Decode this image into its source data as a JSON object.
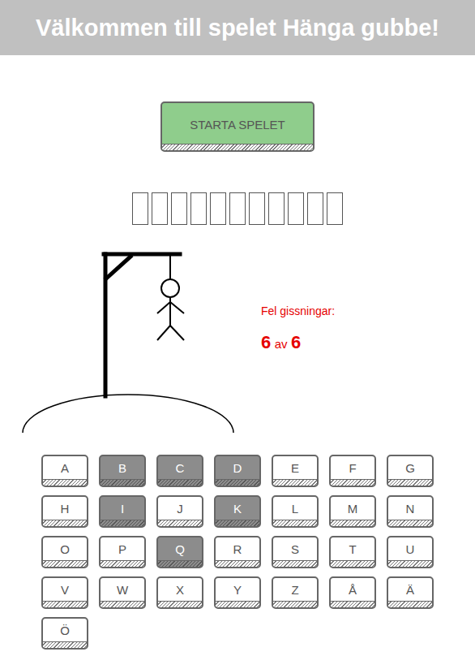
{
  "title": "Välkommen till spelet Hänga gubbe!",
  "start_button": {
    "label": "STARTA SPELET"
  },
  "word_slots": [
    {
      "revealed": false
    },
    {
      "revealed": false
    },
    {
      "revealed": false
    },
    {
      "revealed": false
    },
    {
      "revealed": false
    },
    {
      "revealed": false
    },
    {
      "revealed": false
    },
    {
      "revealed": false
    },
    {
      "revealed": false
    },
    {
      "revealed": false
    },
    {
      "revealed": false
    }
  ],
  "wrong_guesses": {
    "label": "Fel gissningar:",
    "count": "6",
    "separator": "av",
    "max": "6"
  },
  "keys": [
    {
      "letter": "A",
      "disabled": false
    },
    {
      "letter": "B",
      "disabled": true
    },
    {
      "letter": "C",
      "disabled": true
    },
    {
      "letter": "D",
      "disabled": true
    },
    {
      "letter": "E",
      "disabled": false
    },
    {
      "letter": "F",
      "disabled": false
    },
    {
      "letter": "G",
      "disabled": false
    },
    {
      "letter": "H",
      "disabled": false
    },
    {
      "letter": "I",
      "disabled": true
    },
    {
      "letter": "J",
      "disabled": false
    },
    {
      "letter": "K",
      "disabled": true
    },
    {
      "letter": "L",
      "disabled": false
    },
    {
      "letter": "M",
      "disabled": false
    },
    {
      "letter": "N",
      "disabled": false
    },
    {
      "letter": "O",
      "disabled": false
    },
    {
      "letter": "P",
      "disabled": false
    },
    {
      "letter": "Q",
      "disabled": true
    },
    {
      "letter": "R",
      "disabled": false
    },
    {
      "letter": "S",
      "disabled": false
    },
    {
      "letter": "T",
      "disabled": false
    },
    {
      "letter": "U",
      "disabled": false
    },
    {
      "letter": "V",
      "disabled": false
    },
    {
      "letter": "W",
      "disabled": false
    },
    {
      "letter": "X",
      "disabled": false
    },
    {
      "letter": "Y",
      "disabled": false
    },
    {
      "letter": "Z",
      "disabled": false
    },
    {
      "letter": "Å",
      "disabled": false
    },
    {
      "letter": "Ä",
      "disabled": false
    },
    {
      "letter": "Ö",
      "disabled": false
    }
  ]
}
